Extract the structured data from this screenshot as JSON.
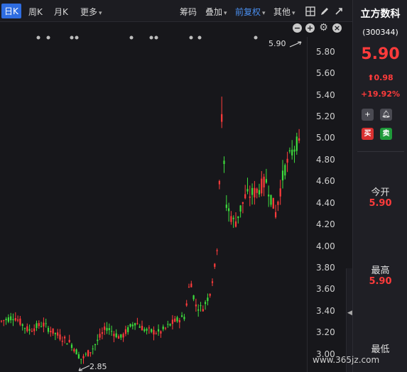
{
  "toolbar": {
    "tabs": [
      {
        "label": "日K",
        "active": true
      },
      {
        "label": "周K",
        "active": false
      },
      {
        "label": "月K",
        "active": false
      }
    ],
    "more_label": "更多",
    "chip_label": "筹码",
    "overlay_label": "叠加",
    "adjust_label": "前复权",
    "other_label": "其他"
  },
  "chart": {
    "high_label": "5.90",
    "low_label": "2.85",
    "up_color": "#ff3b3b",
    "down_color": "#3ddc3d",
    "axis_ticks": [
      "5.80",
      "5.60",
      "5.40",
      "5.20",
      "5.00",
      "4.80",
      "4.60",
      "4.40",
      "4.20",
      "4.00",
      "3.80",
      "3.60",
      "3.40",
      "3.20",
      "3.00"
    ]
  },
  "stock": {
    "name": "立方数科",
    "code": "(300344)",
    "price": "5.90",
    "change": "0.98",
    "change_pct": "+19.92%",
    "buy_label": "买",
    "sell_label": "卖",
    "fields": [
      {
        "label": "今开",
        "value": "5.90"
      },
      {
        "label": "最高",
        "value": "5.90"
      },
      {
        "label": "最低",
        "value": ""
      }
    ]
  },
  "watermark": "www.365jz.com"
}
